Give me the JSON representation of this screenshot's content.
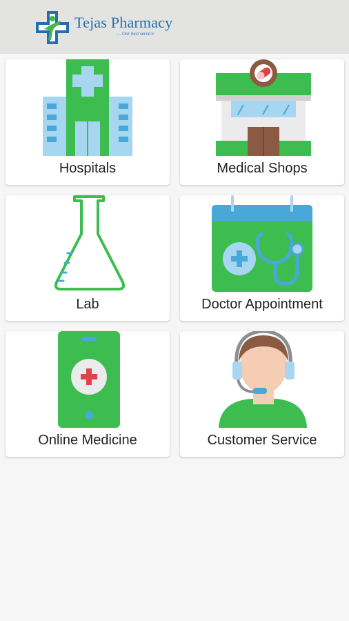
{
  "app": {
    "title": "Tejas Pharmacy",
    "tagline": "... Our best service"
  },
  "tiles": [
    {
      "label": "Hospitals",
      "icon": "hospital-icon"
    },
    {
      "label": "Medical Shops",
      "icon": "medical-shop-icon"
    },
    {
      "label": "Lab",
      "icon": "lab-flask-icon"
    },
    {
      "label": "Doctor Appointment",
      "icon": "doctor-appointment-icon"
    },
    {
      "label": "Online Medicine",
      "icon": "online-medicine-phone-icon"
    },
    {
      "label": "Customer Service",
      "icon": "customer-service-agent-icon"
    }
  ],
  "colors": {
    "green": "#3dbc4f",
    "blue": "#4aa8d8",
    "red": "#e2434b",
    "appbar": "#e3e3e1",
    "background": "#f6f6f6"
  }
}
